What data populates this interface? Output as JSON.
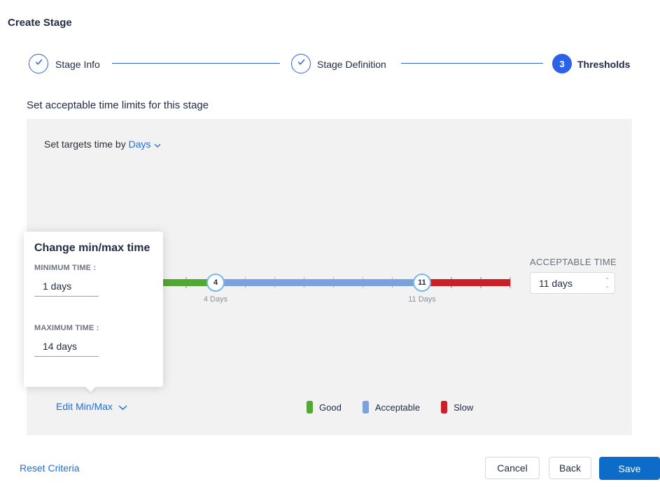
{
  "page": {
    "title": "Create Stage"
  },
  "stepper": {
    "steps": [
      {
        "label": "Stage Info",
        "state": "complete"
      },
      {
        "label": "Stage Definition",
        "state": "complete"
      },
      {
        "label": "Thresholds",
        "state": "active",
        "number": "3"
      }
    ]
  },
  "subtitle": "Set acceptable time limits for this stage",
  "panel": {
    "targets_label": "Set targets time by",
    "targets_value": "Days",
    "slider": {
      "min_day": 1,
      "max_day": 14,
      "handles": [
        {
          "value": "4",
          "label": "4 Days"
        },
        {
          "value": "11",
          "label": "11 Days"
        }
      ],
      "colors": {
        "good": "#53a733",
        "acceptable": "#7ba1de",
        "slow": "#c92127"
      }
    },
    "acceptable_time": {
      "label": "ACCEPTABLE TIME",
      "value": "11 days"
    },
    "edit_minmax_label": "Edit Min/Max",
    "legend": [
      {
        "label": "Good",
        "color": "#53a733"
      },
      {
        "label": "Acceptable",
        "color": "#7ba1de"
      },
      {
        "label": "Slow",
        "color": "#c92127"
      }
    ]
  },
  "popup": {
    "title": "Change min/max time",
    "min_label": "MINIMUM TIME :",
    "min_value": "1 days",
    "max_label": "MAXIMUM TIME :",
    "max_value": "14 days"
  },
  "footer": {
    "reset_label": "Reset Criteria",
    "cancel_label": "Cancel",
    "back_label": "Back",
    "save_label": "Save"
  }
}
